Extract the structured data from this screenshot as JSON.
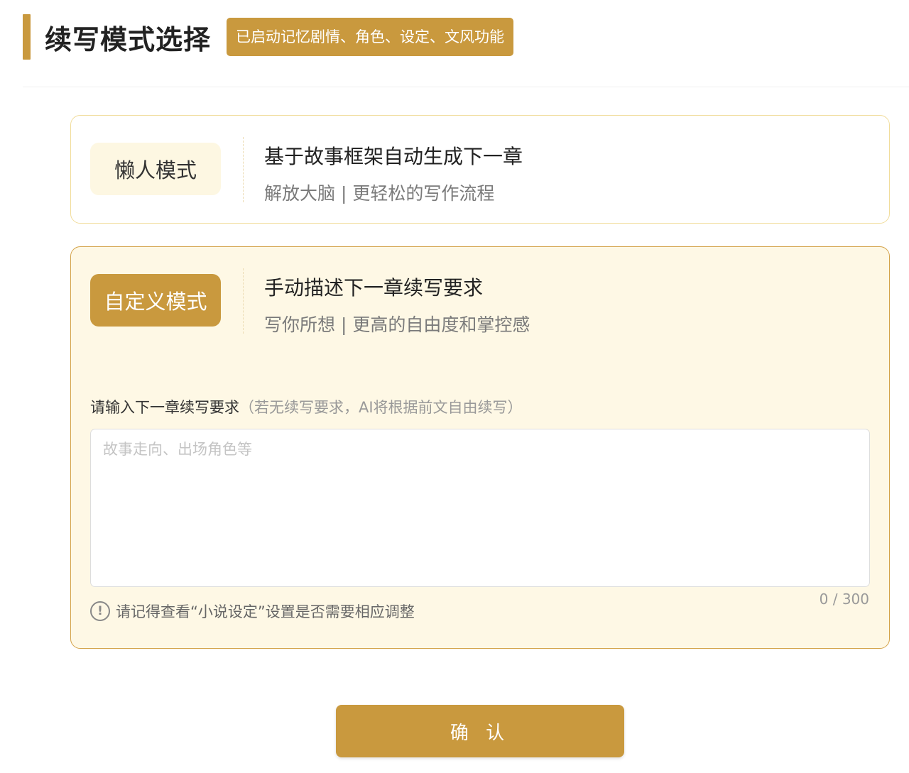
{
  "header": {
    "title": "续写模式选择",
    "badge": "已启动记忆剧情、角色、设定、文风功能"
  },
  "modes": [
    {
      "label": "懒人模式",
      "title": "基于故事框架自动生成下一章",
      "subtitle": "解放大脑 | 更轻松的写作流程",
      "selected": false
    },
    {
      "label": "自定义模式",
      "title": "手动描述下一章续写要求",
      "subtitle": "写你所想 | 更高的自由度和掌控感",
      "selected": true
    }
  ],
  "custom_input": {
    "label": "请输入下一章续写要求",
    "hint": "（若无续写要求，AI将根据前文自由续写）",
    "placeholder": "故事走向、出场角色等",
    "value": "",
    "char_count": "0 / 300"
  },
  "notice": {
    "icon": "exclamation-circle-icon",
    "text": "请记得查看“小说设定”设置是否需要相应调整"
  },
  "confirm_label": "确 认",
  "colors": {
    "accent": "#c9993e",
    "selected_card_bg": "#fef8e5",
    "lazy_pill_bg": "#fdf7e2"
  }
}
